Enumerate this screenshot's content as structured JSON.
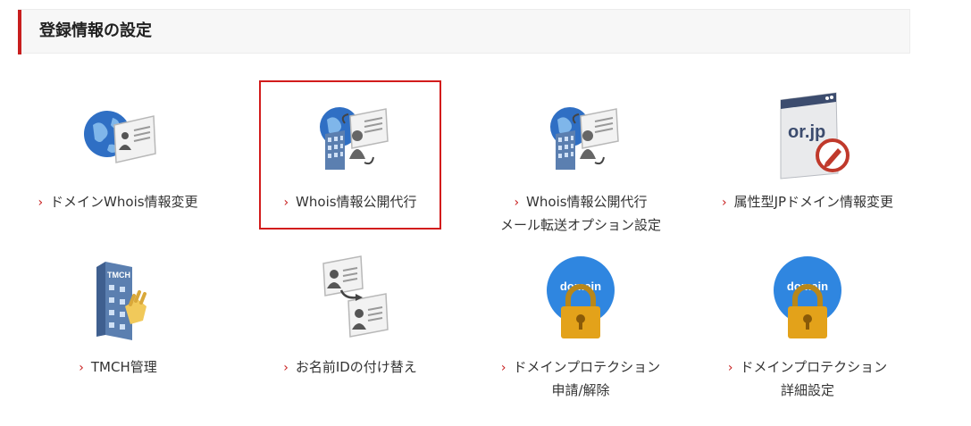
{
  "section": {
    "title": "登録情報の設定"
  },
  "items": [
    {
      "name": "domain-whois-change",
      "label_lines": [
        "ドメインWhois情報変更"
      ],
      "icon": "globe-id-card-icon",
      "selected": false
    },
    {
      "name": "whois-proxy",
      "label_lines": [
        "Whois情報公開代行"
      ],
      "icon": "building-globe-id-card-icon",
      "selected": true
    },
    {
      "name": "whois-proxy-mail-forward",
      "label_lines": [
        "Whois情報公開代行",
        "メール転送オプション設定"
      ],
      "icon": "building-globe-id-card-icon",
      "selected": false
    },
    {
      "name": "attribute-jp-domain-change",
      "label_lines": [
        "属性型JPドメイン情報変更"
      ],
      "icon": "or-jp-edit-icon",
      "selected": false
    },
    {
      "name": "tmch-management",
      "label_lines": [
        "TMCH管理"
      ],
      "icon": "tmch-building-icon",
      "selected": false
    },
    {
      "name": "onamae-id-replace",
      "label_lines": [
        "お名前IDの付け替え"
      ],
      "icon": "id-card-transfer-icon",
      "selected": false
    },
    {
      "name": "domain-protection-apply",
      "label_lines": [
        "ドメインプロテクション",
        "申請/解除"
      ],
      "icon": "domain-lock-icon",
      "selected": false
    },
    {
      "name": "domain-protection-detail",
      "label_lines": [
        "ドメインプロテクション",
        "詳細設定"
      ],
      "icon": "domain-lock-icon",
      "selected": false
    }
  ],
  "icon_text": {
    "orjp": "or.jp",
    "tmch": "TMCH",
    "domain": "domain"
  },
  "colors": {
    "accent": "#c81e1e",
    "selected_border": "#d21c1c",
    "globe": "#2f6fc4",
    "lock_gold": "#e3a21a",
    "building": "#5b7fb0"
  }
}
